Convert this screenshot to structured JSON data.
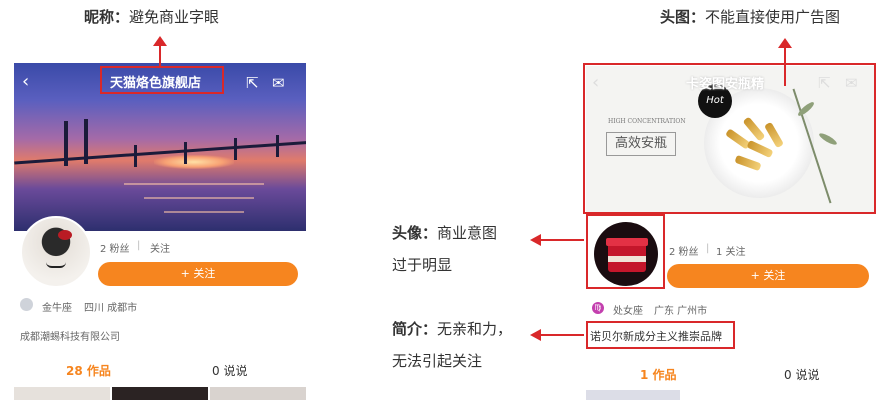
{
  "left_phone": {
    "shop_name": "天猫烙色旗舰店",
    "followers": "2 粉丝",
    "following": "关注",
    "follow_button": "+ 关注",
    "horoscope": "金牛座",
    "location": "四川 成都市",
    "intro": "成都潮蜴科技有限公司",
    "tab_works": "28 作品",
    "tab_talks": "0 说说"
  },
  "right_phone": {
    "title_overlay": "卡姿图安瓶精",
    "hot_badge": "Hot",
    "banner_small": "HIGH CONCENTRATION",
    "banner_big": "高效安瓶",
    "followers": "2 粉丝",
    "following": "1 关注",
    "follow_button": "+ 关注",
    "horoscope": "处女座",
    "location": "广东 广州市",
    "intro": "诺贝尔新成分主义推崇品牌",
    "tab_works": "1 作品",
    "tab_talks": "0 说说"
  },
  "annotations": {
    "nickname_label": "昵称：",
    "nickname_text": "避免商业字眼",
    "header_label": "头图：",
    "header_text": "不能直接使用广告图",
    "avatar_label": "头像：",
    "avatar_text_1": "商业意图",
    "avatar_text_2": "过于明显",
    "intro_label": "简介：",
    "intro_text_1": "无亲和力，",
    "intro_text_2": "无法引起关注"
  },
  "colors": {
    "accent": "#f6851f",
    "annotation": "#d9282a"
  }
}
